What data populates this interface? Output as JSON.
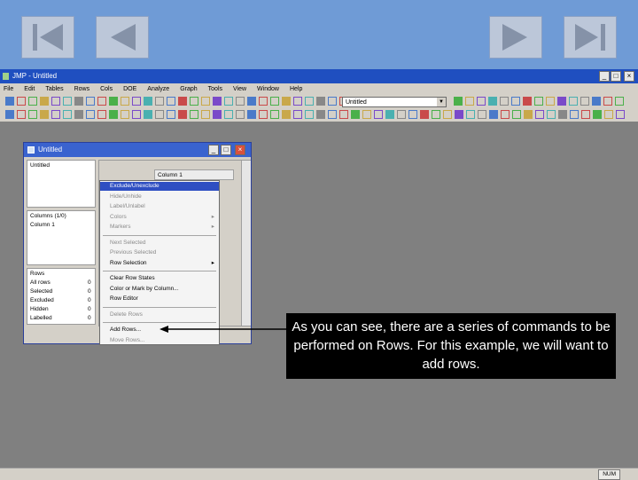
{
  "nav": {
    "first_icon": "skip-to-first-icon",
    "prev_icon": "previous-icon",
    "next_icon": "next-icon",
    "last_icon": "skip-to-last-icon"
  },
  "app": {
    "title": "JMP - Untitled",
    "menus": [
      "File",
      "Edit",
      "Tables",
      "Rows",
      "Cols",
      "DOE",
      "Analyze",
      "Graph",
      "Tools",
      "View",
      "Window",
      "Help"
    ],
    "table_combo_value": "Untitled"
  },
  "data_table": {
    "title": "Untitled",
    "table_panel_label": "Untitled",
    "column_header": "Column 1",
    "columns_panel_header": "Columns (1/0)",
    "column_item": "Column 1",
    "rows_panel_header": "Rows",
    "row_stats": [
      {
        "label": "All rows",
        "value": "0"
      },
      {
        "label": "Selected",
        "value": "0"
      },
      {
        "label": "Excluded",
        "value": "0"
      },
      {
        "label": "Hidden",
        "value": "0"
      },
      {
        "label": "Labelled",
        "value": "0"
      }
    ]
  },
  "context_menu": {
    "items": [
      {
        "label": "Exclude/Unexclude",
        "state": "highlighted"
      },
      {
        "label": "Hide/Unhide",
        "state": "disabled"
      },
      {
        "label": "Label/Unlabel",
        "state": "disabled"
      },
      {
        "label": "Colors",
        "state": "disabled",
        "submenu": "▸"
      },
      {
        "label": "Markers",
        "state": "disabled",
        "submenu": "▸"
      },
      {
        "label": "Next Selected",
        "state": "disabled"
      },
      {
        "label": "Previous Selected",
        "state": "disabled"
      },
      {
        "label": "Row Selection",
        "state": "enabled",
        "submenu": "▸"
      },
      {
        "label": "Clear Row States",
        "state": "enabled"
      },
      {
        "label": "Color or Mark by Column...",
        "state": "enabled"
      },
      {
        "label": "Row Editor",
        "state": "enabled"
      },
      {
        "label": "Delete Rows",
        "state": "disabled"
      },
      {
        "label": "Add Rows...",
        "state": "enabled"
      },
      {
        "label": "Move Rows...",
        "state": "disabled"
      }
    ]
  },
  "callout": {
    "text": "As you can see, there are a series of commands to be performed on Rows. For this example, we will want to add rows."
  },
  "status": {
    "badge": "NUM"
  },
  "colors": {
    "slide_bg": "#6f9bd6",
    "title_blue": "#1f4fc0",
    "highlight": "#2f4fc2",
    "callout_bg": "#000000"
  }
}
